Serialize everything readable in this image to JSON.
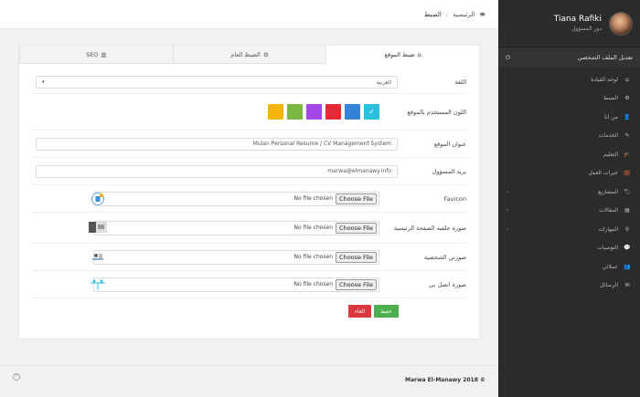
{
  "breadcrumb": {
    "home": "الرئيسية",
    "separator": "/",
    "current": "الضبط",
    "menu_icon": "≡"
  },
  "tabs": [
    {
      "label": "ضبط الموقع",
      "icon": "⌂"
    },
    {
      "label": "الضبط العام",
      "icon": "⚙"
    },
    {
      "label": "SEO",
      "icon": "▥"
    }
  ],
  "form": {
    "language": {
      "label": "اللغة",
      "value": "العربية"
    },
    "color": {
      "label": "اللون المستخدم بالموقع",
      "colors": [
        "#2ac1dd",
        "#3383d8",
        "#e22b35",
        "#a347e6",
        "#7ab843",
        "#f5b40b"
      ],
      "selected_mark": "✓"
    },
    "site_title": {
      "label": "عنوان الموقع",
      "value": "Mulan Personal Resume / CV Management System"
    },
    "admin_email": {
      "label": "بريد المسؤول",
      "value": "marwa@elmanawy.info"
    },
    "favicon": {
      "label": "Favicon",
      "button": "Choose File",
      "status": "No file chosen"
    },
    "home_bg": {
      "label": "صورة خلفيه الصفحة الرئيسية",
      "button": "Choose File",
      "status": "No file chosen"
    },
    "profile_photo": {
      "label": "صورتي الشخصية",
      "button": "Choose File",
      "status": "No file chosen"
    },
    "contact_photo": {
      "label": "صورة اتصل بي",
      "button": "Choose File",
      "status": "No file chosen"
    }
  },
  "actions": {
    "save": "حفظ",
    "cancel": "الغاء",
    "save_color": "#4cae4c",
    "cancel_color": "#d9383f"
  },
  "footer": {
    "copyright": "Marwa El-Manawy 2018 ©",
    "up_icon": "^"
  },
  "sidebar": {
    "name": "Tiana Rafiki",
    "role": "دور المسؤول",
    "edit_profile": "تعديل الملف الشخصي",
    "power_icon": "⏻",
    "items": [
      {
        "label": "لوحة القيادة",
        "icon": "⌂",
        "chevron": ""
      },
      {
        "label": "الضبط",
        "icon": "⚙",
        "chevron": ""
      },
      {
        "label": "من انا",
        "icon": "👤",
        "chevron": ""
      },
      {
        "label": "الخدمات",
        "icon": "✎",
        "chevron": ""
      },
      {
        "label": "التعليم",
        "icon": "🎓",
        "chevron": ""
      },
      {
        "label": "خبرات العمل",
        "icon": "💼",
        "chevron": ""
      },
      {
        "label": "المشاريع",
        "icon": "🏷",
        "chevron": "‹"
      },
      {
        "label": "المقالات",
        "icon": "▤",
        "chevron": "‹"
      },
      {
        "label": "المهارات",
        "icon": "⚲",
        "chevron": "‹"
      },
      {
        "label": "التوصيات",
        "icon": "💬",
        "chevron": ""
      },
      {
        "label": "عملائي",
        "icon": "👥",
        "chevron": ""
      },
      {
        "label": "الرسائل",
        "icon": "✉",
        "chevron": ""
      }
    ]
  }
}
